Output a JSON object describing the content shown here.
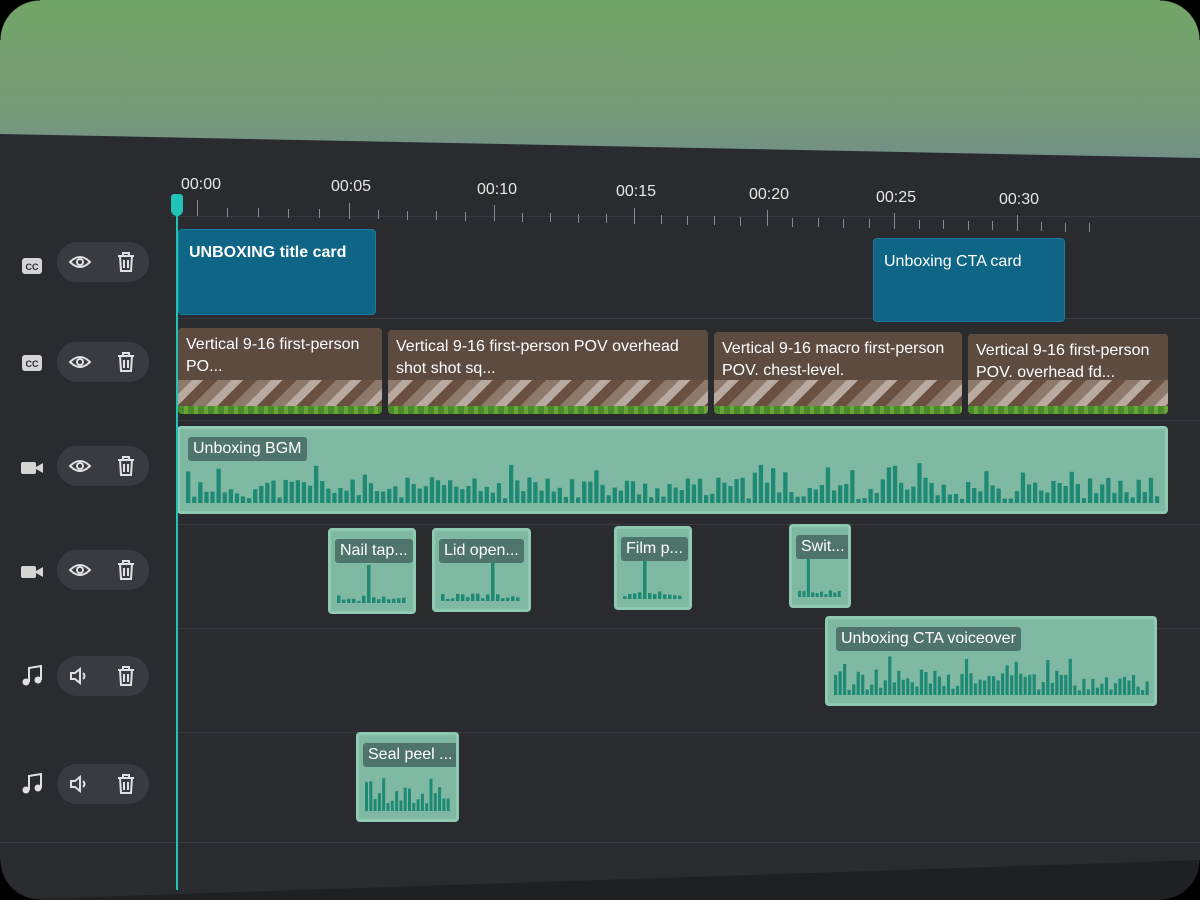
{
  "timeline": {
    "ruler": [
      "00:00",
      "00:05",
      "00:10",
      "00:15",
      "00:20",
      "00:25",
      "00:30"
    ]
  },
  "tracks": [
    {
      "type_icon": "cc-icon",
      "toggle_icon": "eye-icon",
      "delete_icon": "trash-icon"
    },
    {
      "type_icon": "cc-icon",
      "toggle_icon": "eye-icon",
      "delete_icon": "trash-icon"
    },
    {
      "type_icon": "video-camera-icon",
      "toggle_icon": "eye-icon",
      "delete_icon": "trash-icon"
    },
    {
      "type_icon": "video-camera-icon",
      "toggle_icon": "eye-icon",
      "delete_icon": "trash-icon"
    },
    {
      "type_icon": "music-note-icon",
      "toggle_icon": "speaker-icon",
      "delete_icon": "trash-icon"
    },
    {
      "type_icon": "music-note-icon",
      "toggle_icon": "speaker-icon",
      "delete_icon": "trash-icon"
    }
  ],
  "clips": {
    "title_card": "UNBOXING title card",
    "cta_card": "Unboxing CTA card",
    "video1": "Vertical 9-16 first-person PO...",
    "video2": "Vertical 9-16 first-person POV overhead shot shot sq...",
    "video3": "Vertical 9-16 macro first-person POV. chest-level.",
    "video4": "Vertical 9-16 first-person POV. overhead fd...",
    "bgm": "Unboxing BGM",
    "sfx1": "Nail tap...",
    "sfx2": "Lid open...",
    "sfx3": "Film p...",
    "sfx4": "Swit...",
    "voiceover": "Unboxing CTA voiceover",
    "sfx5": "Seal peel ..."
  },
  "colors": {
    "accent": "#21c3b7",
    "title_clip": "#0f6585",
    "audio_clip": "#7fb9a4",
    "waveform": "#1e8a74"
  }
}
